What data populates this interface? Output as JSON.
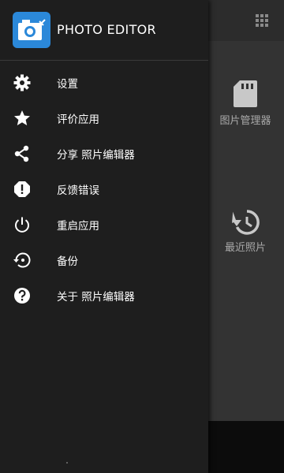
{
  "app": {
    "title": "PHOTO EDITOR"
  },
  "menu": {
    "items": [
      {
        "label": "设置",
        "icon": "gear-icon"
      },
      {
        "label": "评价应用",
        "icon": "star-icon"
      },
      {
        "label": "分享 照片编辑器",
        "icon": "share-icon"
      },
      {
        "label": "反馈错误",
        "icon": "bug-report-icon"
      },
      {
        "label": "重启应用",
        "icon": "power-icon"
      },
      {
        "label": "备份",
        "icon": "backup-restore-icon"
      },
      {
        "label": "关于 照片编辑器",
        "icon": "help-icon"
      }
    ]
  },
  "background": {
    "tiles": [
      {
        "label": "图片管理器",
        "icon": "sd-card-icon"
      },
      {
        "label": "最近照片",
        "icon": "history-icon"
      }
    ]
  },
  "colors": {
    "accent": "#2b88d9",
    "drawer_bg": "#1e1e1e",
    "main_bg": "#333333"
  }
}
